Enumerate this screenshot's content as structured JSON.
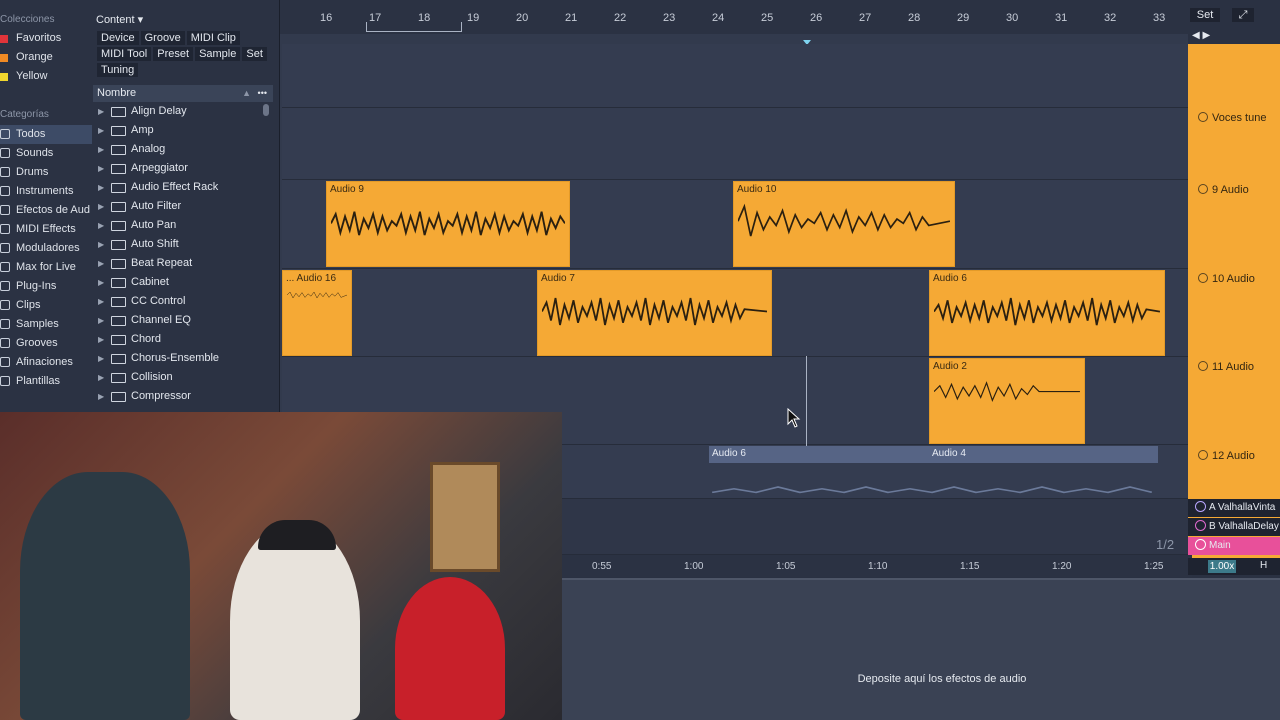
{
  "browser": {
    "collections_title": "Colecciones",
    "collections": [
      {
        "label": "Favoritos",
        "color": "#e0343a"
      },
      {
        "label": "Orange",
        "color": "#f08a24"
      },
      {
        "label": "Yellow",
        "color": "#f0d62e"
      }
    ],
    "categories_title": "Categorías",
    "categories": [
      "Todos",
      "Sounds",
      "Drums",
      "Instruments",
      "Efectos de Aud",
      "MIDI Effects",
      "Moduladores",
      "Max for Live",
      "Plug-Ins",
      "Clips",
      "Samples",
      "Grooves",
      "Afinaciones",
      "Plantillas"
    ],
    "content_label": "Content ▾",
    "tags": [
      "Device",
      "Groove",
      "MIDI Clip",
      "MIDI Tool",
      "Preset",
      "Sample",
      "Set",
      "Tuning"
    ],
    "list_header": "Nombre",
    "items": [
      "Align Delay",
      "Amp",
      "Analog",
      "Arpeggiator",
      "Audio Effect Rack",
      "Auto Filter",
      "Auto Pan",
      "Auto Shift",
      "Beat Repeat",
      "Cabinet",
      "CC Control",
      "Channel EQ",
      "Chord",
      "Chorus-Ensemble",
      "Collision",
      "Compressor"
    ]
  },
  "ruler": {
    "bars": [
      "16",
      "17",
      "18",
      "19",
      "20",
      "21",
      "22",
      "23",
      "24",
      "25",
      "26",
      "27",
      "28",
      "29",
      "30",
      "31",
      "32",
      "33"
    ],
    "set_label": "Set"
  },
  "clips": [
    {
      "name": "Audio 9"
    },
    {
      "name": "Audio 10"
    },
    {
      "name": "... Audio 16"
    },
    {
      "name": "Audio 7"
    },
    {
      "name": "Audio 6"
    },
    {
      "name": "Audio 2"
    },
    {
      "name": "Audio 6"
    },
    {
      "name": "Audio 4"
    }
  ],
  "tracks": [
    {
      "label": "Voces tune"
    },
    {
      "label": "9 Audio"
    },
    {
      "label": "10 Audio"
    },
    {
      "label": "11 Audio"
    },
    {
      "label": "12 Audio"
    }
  ],
  "returns": [
    {
      "label": "A ValhallaVinta"
    },
    {
      "label": "B ValhallaDelay"
    },
    {
      "label": "Main"
    }
  ],
  "page_indicator": "1/2",
  "time_marks": [
    "0:55",
    "1:00",
    "1:05",
    "1:10",
    "1:15",
    "1:20",
    "1:25"
  ],
  "zoom": "1.00x",
  "h_label": "H",
  "device_drop_hint": "Deposite aquí los efectos de audio"
}
